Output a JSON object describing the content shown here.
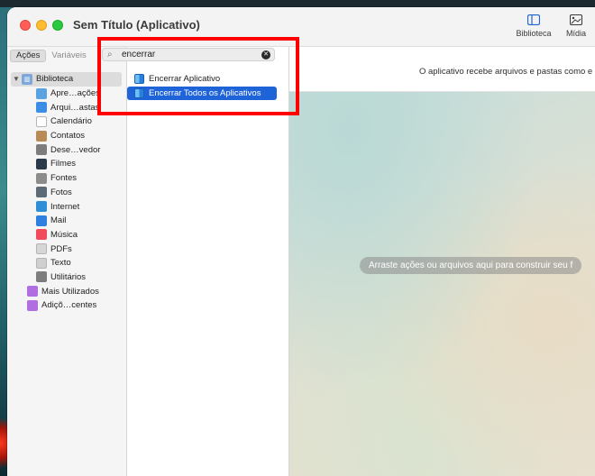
{
  "window": {
    "title": "Sem Título (Aplicativo)"
  },
  "toolbar": {
    "library_label": "Biblioteca",
    "media_label": "Mídia"
  },
  "library_panel": {
    "tabs": [
      {
        "label": "Ações",
        "active": true
      },
      {
        "label": "Variáveis",
        "active": false
      }
    ],
    "root": {
      "label": "Biblioteca",
      "expanded": true
    },
    "items": [
      {
        "label": "Apre…ações",
        "icon": "presentation-icon",
        "color": "#5ba3e0"
      },
      {
        "label": "Arqui…astas",
        "icon": "finder-icon",
        "color": "#3a8ee6"
      },
      {
        "label": "Calendário",
        "icon": "calendar-icon",
        "color": "#ffffff"
      },
      {
        "label": "Contatos",
        "icon": "contacts-icon",
        "color": "#b88b56"
      },
      {
        "label": "Dese…vedor",
        "icon": "developer-icon",
        "color": "#7d7d7d"
      },
      {
        "label": "Filmes",
        "icon": "movies-icon",
        "color": "#2a3a4a"
      },
      {
        "label": "Fontes",
        "icon": "fonts-icon",
        "color": "#8c8c8c"
      },
      {
        "label": "Fotos",
        "icon": "photos-icon",
        "color": "#5d6b77"
      },
      {
        "label": "Internet",
        "icon": "internet-icon",
        "color": "#2c8fd8"
      },
      {
        "label": "Mail",
        "icon": "mail-icon",
        "color": "#2e7fe0"
      },
      {
        "label": "Música",
        "icon": "music-icon",
        "color": "#f04b5b"
      },
      {
        "label": "PDFs",
        "icon": "pdf-icon",
        "color": "#d6d6d6"
      },
      {
        "label": "Texto",
        "icon": "text-icon",
        "color": "#cfcfcf"
      },
      {
        "label": "Utilitários",
        "icon": "utilities-icon",
        "color": "#7d7d7d"
      }
    ],
    "folders": [
      {
        "label": "Mais Utilizados",
        "icon": "smart-folder-icon",
        "color": "#b06ee0"
      },
      {
        "label": "Adiçõ…centes",
        "icon": "smart-folder-icon",
        "color": "#b06ee0"
      }
    ]
  },
  "search": {
    "value": "encerrar"
  },
  "results": [
    {
      "label": "Encerrar Aplicativo",
      "selected": false
    },
    {
      "label": "Encerrar Todos os Aplicativos",
      "selected": true
    }
  ],
  "workflow": {
    "info_text": "O aplicativo recebe arquivos e pastas como e",
    "drop_hint": "Arraste ações ou arquivos aqui para construir seu f"
  },
  "colors": {
    "selection": "#1f63d9",
    "highlight_box": "#ff0000"
  }
}
